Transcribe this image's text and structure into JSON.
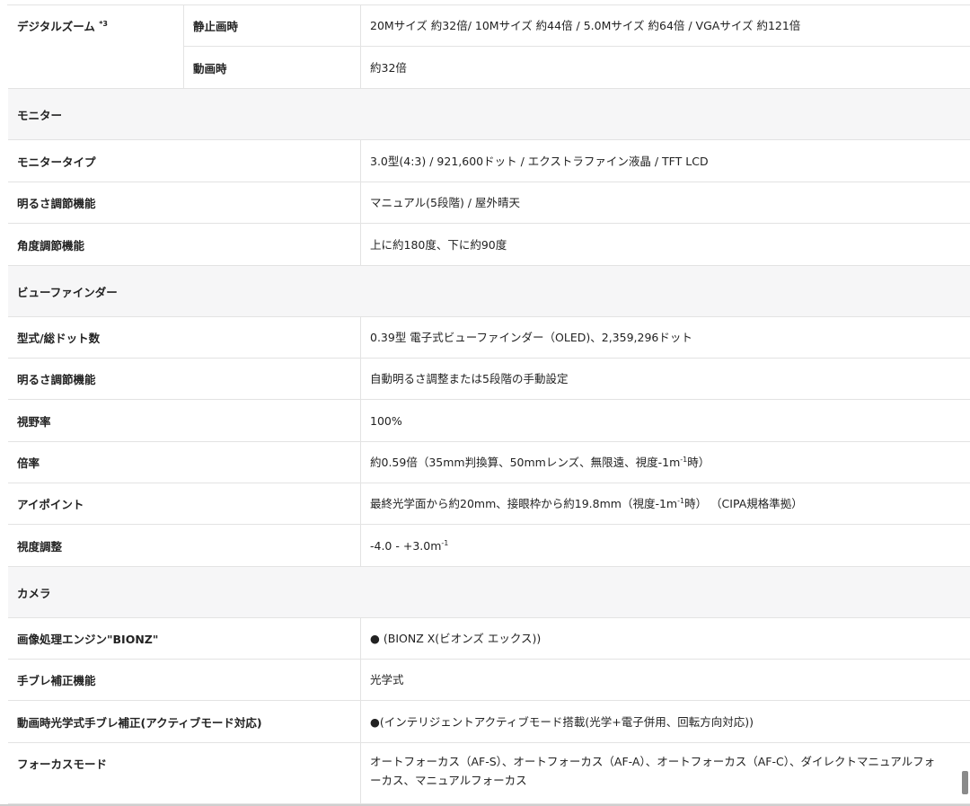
{
  "digital_zoom": {
    "label": "デジタルズーム",
    "sup": "*3",
    "still_label": "静止画時",
    "still_value": "20Mサイズ 約32倍/ 10Mサイズ 約44倍 / 5.0Mサイズ 約64倍 / VGAサイズ 約121倍",
    "movie_label": "動画時",
    "movie_value": "約32倍"
  },
  "monitor": {
    "section": "モニター",
    "rows": [
      {
        "label": "モニタータイプ",
        "value": "3.0型(4:3) / 921,600ドット / エクストラファイン液晶 / TFT LCD"
      },
      {
        "label": "明るさ調節機能",
        "value": "マニュアル(5段階) / 屋外晴天"
      },
      {
        "label": "角度調節機能",
        "value": "上に約180度、下に約90度"
      }
    ]
  },
  "viewfinder": {
    "section": "ビューファインダー",
    "rows": [
      {
        "label": "型式/総ドット数",
        "value": "0.39型 電子式ビューファインダー（OLED)、2,359,296ドット"
      },
      {
        "label": "明るさ調節機能",
        "value": "自動明るさ調整または5段階の手動設定"
      },
      {
        "label": "視野率",
        "value": "100%"
      }
    ],
    "magnification": {
      "label": "倍率",
      "value_pre": "約0.59倍（35mm判換算、50mmレンズ、無限遠、視度-1m",
      "value_sup": "-1",
      "value_post": "時）"
    },
    "eyepoint": {
      "label": "アイポイント",
      "value_pre": "最終光学面から約20mm、接眼枠から約19.8mm（視度-1m",
      "value_sup": "-1",
      "value_post": "時） （CIPA規格準拠）"
    },
    "diopter": {
      "label": "視度調整",
      "value_pre": "-4.0 - +3.0m",
      "value_sup": "-1"
    }
  },
  "camera": {
    "section": "カメラ",
    "rows": [
      {
        "label": "画像処理エンジン\"BIONZ\"",
        "value": "● (BIONZ X(ビオンズ エックス))"
      },
      {
        "label": "手ブレ補正機能",
        "value": "光学式"
      },
      {
        "label": "動画時光学式手ブレ補正(アクティブモード対応)",
        "value": "●(インテリジェントアクティブモード搭載(光学+電子併用、回転方向対応))"
      }
    ],
    "focus": {
      "label": "フォーカスモード",
      "value_line1": "オートフォーカス（AF-S）、オートフォーカス（AF-A）、オートフォーカス（AF-C）、ダイレクトマニュアルフォ",
      "value_line2": "ーカス、マニュアルフォーカス"
    }
  }
}
